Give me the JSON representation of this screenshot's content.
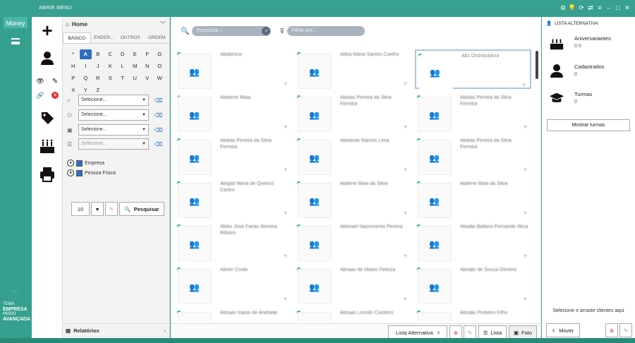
{
  "topbar": {
    "menu_label": "ABRIR MENU"
  },
  "logo": {
    "text": "Money"
  },
  "rail": {
    "tema_label": "TEMA",
    "tema_value": "EMPRESA",
    "modo_label": "MODO",
    "modo_value": "AVANÇADA"
  },
  "filter": {
    "header": "Home",
    "tabs": [
      "BÁSICO",
      "ENDER...",
      "OUTROS",
      "ORDEM"
    ],
    "letters": [
      "*",
      "A",
      "B",
      "C",
      "D",
      "E",
      "F",
      "G",
      "H",
      "I",
      "J",
      "K",
      "L",
      "M",
      "N",
      "O",
      "P",
      "Q",
      "R",
      "S",
      "T",
      "U",
      "V",
      "W",
      "X",
      "Y",
      "Z"
    ],
    "selected_letter": "A",
    "selects": [
      {
        "value": "Selecione...",
        "disabled": false
      },
      {
        "value": "Selecione...",
        "disabled": false
      },
      {
        "value": "Selecione...",
        "disabled": false
      },
      {
        "value": "Selecione...",
        "disabled": true
      }
    ],
    "checks": [
      {
        "label": "Empresa",
        "checked": true
      },
      {
        "label": "Pessoa Física",
        "checked": true
      }
    ],
    "page_size": "10",
    "search_label": "Pesquisar",
    "reports_label": "Relatórios"
  },
  "main": {
    "search_placeholder": "Pesquisar...",
    "filter_placeholder": "Filtrar por...",
    "cards": [
      {
        "name": "Abatiinica",
        "active": true,
        "selected": false
      },
      {
        "name": "Abba Maria Santos Coelho",
        "active": true,
        "selected": false
      },
      {
        "name": "Abc Distribuidora",
        "active": true,
        "selected": true
      },
      {
        "name": "Abdemir Maia",
        "active": false,
        "selected": false
      },
      {
        "name": "Abdias Pereira da Silva Ferreira",
        "active": true,
        "selected": false
      },
      {
        "name": "Abdias Pereira da Silva Ferreira",
        "active": true,
        "selected": false
      },
      {
        "name": "Abdias Pereira da Silva Ferreira",
        "active": true,
        "selected": false
      },
      {
        "name": "Abelardo Ramos Lima",
        "active": true,
        "selected": false
      },
      {
        "name": "Abdias Pereira da Silva Ferreira",
        "active": true,
        "selected": false
      },
      {
        "name": "Abigail Maria de Queiroz Castro",
        "active": true,
        "selected": false
      },
      {
        "name": "Abilene Maia da Silva",
        "active": true,
        "selected": false
      },
      {
        "name": "Abilene Maia da Silva",
        "active": true,
        "selected": false
      },
      {
        "name": "Abilio Jose Farias Moreira Ribeiro",
        "active": true,
        "selected": false
      },
      {
        "name": "Abimael Nascimento Pereira",
        "active": true,
        "selected": false
      },
      {
        "name": "Abiaão Balbino Fernando Wica",
        "active": true,
        "selected": false
      },
      {
        "name": "Abner Costa",
        "active": true,
        "selected": false
      },
      {
        "name": "Abraao de Matos Feitoza",
        "active": true,
        "selected": false
      },
      {
        "name": "Abraão de Souza Oliveira",
        "active": true,
        "selected": false
      },
      {
        "name": "Abraao Inacio de Andrade",
        "active": true,
        "selected": false
      },
      {
        "name": "Abraao Lincoln Cordeiro",
        "active": true,
        "selected": false
      },
      {
        "name": "Abraão Pinheiro Filho",
        "active": true,
        "selected": false
      }
    ],
    "bottom": {
      "alt_list": "Lista Alternativa",
      "list": "Lista",
      "photo": "Foto",
      "move": "Mover"
    }
  },
  "right": {
    "title": "LISTA ALTERNATIVA",
    "items": [
      {
        "label": "Aniversariantes",
        "value": "0 0"
      },
      {
        "label": "Cadastrados",
        "value": "0"
      },
      {
        "label": "Turmas",
        "value": "0"
      }
    ],
    "show_classes": "Mostrar turmas",
    "hint": "Selecione e arraste clientes aqui"
  },
  "colors": {
    "teal": "#37a08e",
    "selection_blue": "#2d6fc0",
    "active_green": "#2eb84b"
  }
}
